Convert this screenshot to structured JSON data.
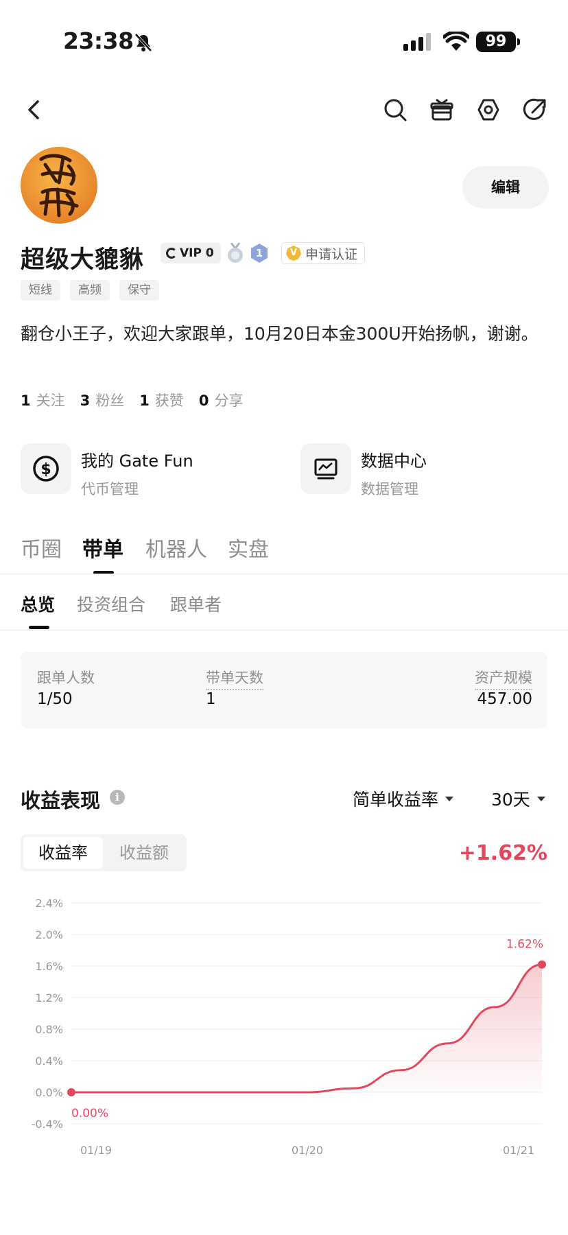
{
  "status_bar": {
    "time": "23:38",
    "battery": "99"
  },
  "profile": {
    "name": "超级大貔貅",
    "vip_label": "VIP 0",
    "level": "1",
    "cert_label": "申请认证",
    "cert_badge": "V",
    "edit_label": "编辑",
    "tags": [
      "短线",
      "高频",
      "保守"
    ],
    "bio": "翻仓小王子，欢迎大家跟单，10月20日本金300U开始扬帆，谢谢。",
    "stats": [
      {
        "n": "1",
        "label": "关注"
      },
      {
        "n": "3",
        "label": "粉丝"
      },
      {
        "n": "1",
        "label": "获赞"
      },
      {
        "n": "0",
        "label": "分享"
      }
    ]
  },
  "quick_cards": [
    {
      "title": "我的 Gate Fun",
      "subtitle": "代币管理",
      "icon": "dollar-coin-icon"
    },
    {
      "title": "数据中心",
      "subtitle": "数据管理",
      "icon": "chart-monitor-icon"
    }
  ],
  "tabs": [
    "币圈",
    "带单",
    "机器人",
    "实盘"
  ],
  "sub_tabs": [
    "总览",
    "投资组合",
    "跟单者"
  ],
  "overview": {
    "followers_label": "跟单人数",
    "followers_value": "1/50",
    "days_label": "带单天数",
    "days_value": "1",
    "aum_label": "资产规模",
    "aum_value": "457.00"
  },
  "earnings": {
    "title": "收益表现",
    "info_icon": "i",
    "mode_dropdown": "简单收益率",
    "range_dropdown": "30天",
    "seg_rate": "收益率",
    "seg_amount": "收益额",
    "change": "+1.62%"
  },
  "colors": {
    "accent_red": "#e0495d",
    "grid": "#eeeeee"
  },
  "chart_data": {
    "type": "area",
    "y_ticks": [
      "2.4%",
      "2.0%",
      "1.6%",
      "1.2%",
      "0.8%",
      "0.4%",
      "0.0%",
      "-0.4%"
    ],
    "ylim": [
      -0.4,
      2.4
    ],
    "x_ticks": [
      "01/19",
      "01/20",
      "01/21"
    ],
    "series": [
      {
        "x": [
          0,
          0.25,
          0.5,
          0.6,
          0.7,
          0.8,
          0.9,
          1.0
        ],
        "values": [
          0.0,
          0.0,
          0.0,
          0.05,
          0.28,
          0.62,
          1.08,
          1.62
        ]
      }
    ],
    "start_label": "0.00%",
    "end_label": "1.62%"
  }
}
